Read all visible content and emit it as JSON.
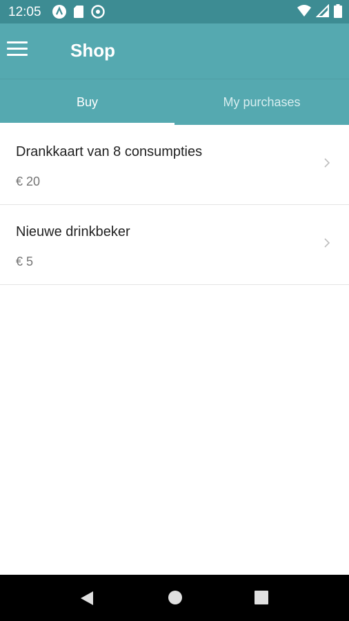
{
  "status_bar": {
    "time": "12:05",
    "left_icons": [
      "a-icon",
      "sd-card-icon",
      "data-saver-icon"
    ],
    "right_icons": [
      "wifi-icon",
      "signal-icon",
      "battery-icon"
    ]
  },
  "app_bar": {
    "title": "Shop",
    "menu_icon": "hamburger-menu-icon"
  },
  "tabs": [
    {
      "label": "Buy",
      "active": true
    },
    {
      "label": "My purchases",
      "active": false
    }
  ],
  "items": [
    {
      "title": "Drankkaart van 8 consumpties",
      "price": "€ 20"
    },
    {
      "title": "Nieuwe drinkbeker",
      "price": "€ 5"
    }
  ],
  "nav_bar": {
    "buttons": [
      "back-icon",
      "home-icon",
      "recents-icon"
    ]
  },
  "colors": {
    "status_bar": "#3d8c93",
    "primary": "#55a9b0",
    "nav_bar": "#000000"
  }
}
